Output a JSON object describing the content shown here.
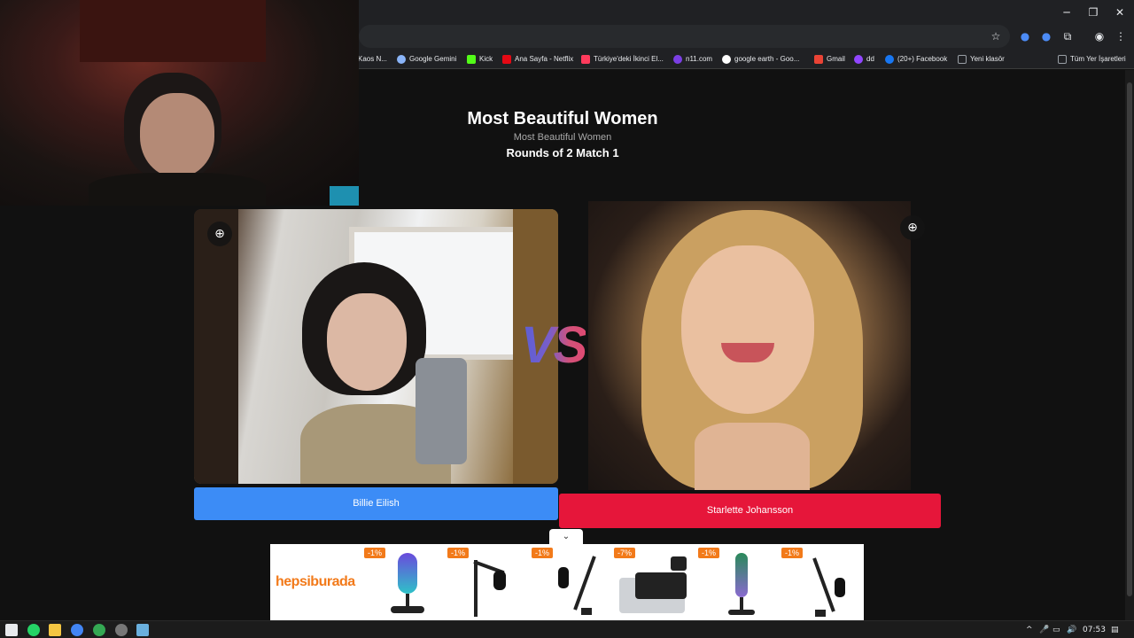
{
  "window": {
    "minimize_icon": "minimize-icon",
    "restore_icon": "restore-icon",
    "close_icon": "close-icon"
  },
  "address_bar": {
    "star_icon": "star-icon",
    "extension_icons": [
      "extension-blue-icon",
      "extension-ai-icon",
      "puzzle-icon",
      "profile-icon",
      "menu-icon"
    ]
  },
  "bookmarks": {
    "items": [
      {
        "label": "Kaos N...",
        "color": "#b0b0b0"
      },
      {
        "label": "Google Gemini",
        "color": "#8ab4f8"
      },
      {
        "label": "Kick",
        "color": "#53fc18"
      },
      {
        "label": "Ana Sayfa - Netflix",
        "color": "#e50914"
      },
      {
        "label": "Türkiye'deki İkinci El...",
        "color": "#ff3b5c"
      },
      {
        "label": "n11.com",
        "color": "#7b3fe4"
      },
      {
        "label": "google earth - Goo...",
        "color": "#4285f4"
      },
      {
        "label": "Gmail",
        "color": "#ea4335"
      },
      {
        "label": "dd",
        "color": "#9146ff"
      },
      {
        "label": "(20+) Facebook",
        "color": "#1877f2"
      },
      {
        "label": "Yeni klasör",
        "color": "#9aa0a6"
      }
    ],
    "all_bookmarks": "Tüm Yer İşaretleri"
  },
  "page": {
    "title": "Most Beautiful Women",
    "subtitle": "Most Beautiful Women",
    "round": "Rounds of 2 Match 1",
    "vs": "VS",
    "left_choice": "Billie Eilish",
    "right_choice": "Starlette Johansson",
    "left_color": "#3c8cf6",
    "right_color": "#e6163a"
  },
  "ad": {
    "brand": "hepsiburada",
    "brand_color": "#f27a1a",
    "badges": [
      "-1%",
      "-1%",
      "-1%",
      "-7%",
      "-1%",
      "-1%"
    ]
  },
  "taskbar": {
    "time": "07:53"
  }
}
